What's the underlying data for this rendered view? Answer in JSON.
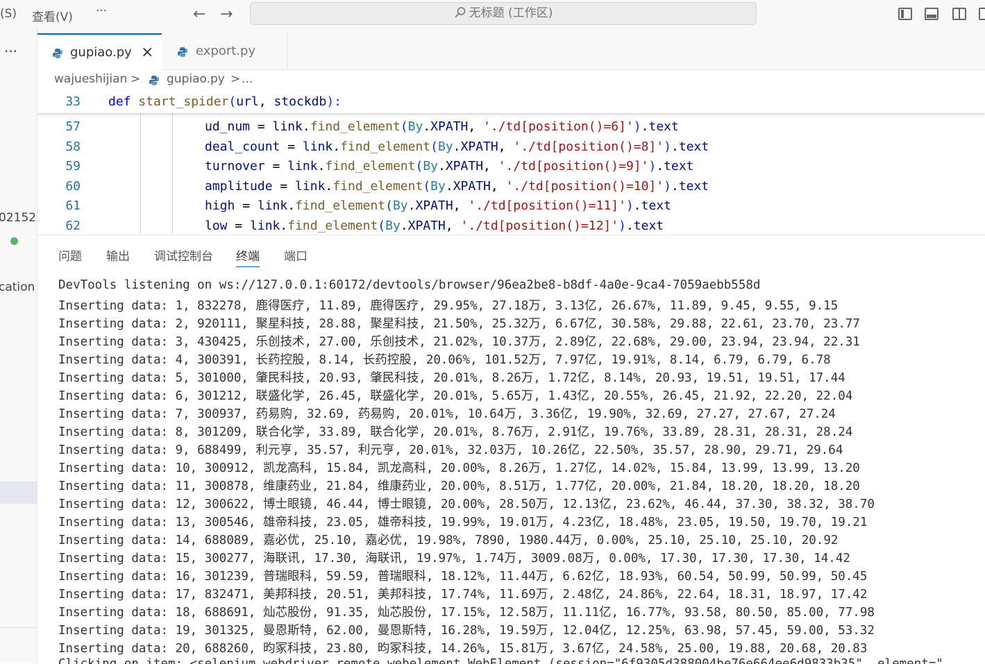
{
  "titlebar": {
    "menu_partial": "(S)",
    "menu_view": "查看(V)",
    "more": "···",
    "back": "←",
    "forward": "→",
    "search": "无标题 (工作区)"
  },
  "sidebar": {
    "more": "···",
    "frag_number": "02152",
    "frag_text": "cation"
  },
  "tabs": [
    {
      "label": "gupiao.py",
      "active": true,
      "close": "×"
    },
    {
      "label": "export.py",
      "active": false
    }
  ],
  "breadcrumb": {
    "folder": "wajueshijian",
    "sep": ">",
    "file": "gupiao.py",
    "more": "..."
  },
  "editor": {
    "sticky": {
      "line": "33",
      "kw": "def",
      "fn": "start_spider",
      "p1": "(",
      "a1": "url",
      "comma": ", ",
      "a2": "stockdb",
      "p2": "):"
    },
    "lines": [
      {
        "num": "57",
        "var": "ud_num",
        "str": "'./td[position()=6]'"
      },
      {
        "num": "58",
        "var": "deal_count",
        "str": "'./td[position()=8]'"
      },
      {
        "num": "59",
        "var": "turnover",
        "str": "'./td[position()=9]'"
      },
      {
        "num": "60",
        "var": "amplitude",
        "str": "'./td[position()=10]'"
      },
      {
        "num": "61",
        "var": "high",
        "str": "'./td[position()=11]'"
      },
      {
        "num": "62",
        "var": "low",
        "str": "'./td[position()=12]'"
      }
    ],
    "tok": {
      "eq": " = ",
      "link": "link",
      "dot": ".",
      "find": "find_element",
      "open": "(",
      "by": "By",
      "xpath": "XPATH",
      "sep": ", ",
      "close": ")",
      "text": "text"
    }
  },
  "panel": {
    "tabs": [
      "问题",
      "输出",
      "调试控制台",
      "终端",
      "端口"
    ],
    "active_tab": "终端",
    "terminal_lines": [
      "DevTools listening on ws://127.0.0.1:60172/devtools/browser/96ea2be8-b8df-4a0e-9ca4-7059aebb558d",
      "Inserting data: 1, 832278, 鹿得医疗, 11.89, 鹿得医疗, 29.95%, 27.18万, 3.13亿, 26.67%, 11.89, 9.45, 9.55, 9.15",
      "Inserting data: 2, 920111, 聚星科技, 28.88, 聚星科技, 21.50%, 25.32万, 6.67亿, 30.58%, 29.88, 22.61, 23.70, 23.77",
      "Inserting data: 3, 430425, 乐创技术, 27.00, 乐创技术, 21.02%, 10.37万, 2.89亿, 22.68%, 29.00, 23.94, 23.94, 22.31",
      "Inserting data: 4, 300391, 长药控股, 8.14, 长药控股, 20.06%, 101.52万, 7.97亿, 19.91%, 8.14, 6.79, 6.79, 6.78",
      "Inserting data: 5, 301000, 肇民科技, 20.93, 肇民科技, 20.01%, 8.26万, 1.72亿, 8.14%, 20.93, 19.51, 19.51, 17.44",
      "Inserting data: 6, 301212, 联盛化学, 26.45, 联盛化学, 20.01%, 5.65万, 1.43亿, 20.55%, 26.45, 21.92, 22.20, 22.04",
      "Inserting data: 7, 300937, 药易购, 32.69, 药易购, 20.01%, 10.64万, 3.36亿, 19.90%, 32.69, 27.27, 27.67, 27.24",
      "Inserting data: 8, 301209, 联合化学, 33.89, 联合化学, 20.01%, 8.76万, 2.91亿, 19.76%, 33.89, 28.31, 28.31, 28.24",
      "Inserting data: 9, 688499, 利元亨, 35.57, 利元亨, 20.01%, 32.03万, 10.26亿, 22.50%, 35.57, 28.90, 29.71, 29.64",
      "Inserting data: 10, 300912, 凯龙高科, 15.84, 凯龙高科, 20.00%, 8.26万, 1.27亿, 14.02%, 15.84, 13.99, 13.99, 13.20",
      "Inserting data: 11, 300878, 维康药业, 21.84, 维康药业, 20.00%, 8.51万, 1.77亿, 20.00%, 21.84, 18.20, 18.20, 18.20",
      "Inserting data: 12, 300622, 博士眼镜, 46.44, 博士眼镜, 20.00%, 28.50万, 12.13亿, 23.62%, 46.44, 37.30, 38.32, 38.70",
      "Inserting data: 13, 300546, 雄帝科技, 23.05, 雄帝科技, 19.99%, 19.01万, 4.23亿, 18.48%, 23.05, 19.50, 19.70, 19.21",
      "Inserting data: 14, 688089, 嘉必优, 25.10, 嘉必优, 19.98%, 7890, 1980.44万, 0.00%, 25.10, 25.10, 25.10, 20.92",
      "Inserting data: 15, 300277, 海联讯, 17.30, 海联讯, 19.97%, 1.74万, 3009.08万, 0.00%, 17.30, 17.30, 17.30, 14.42",
      "Inserting data: 16, 301239, 普瑞眼科, 59.59, 普瑞眼科, 18.12%, 11.44万, 6.62亿, 18.93%, 60.54, 50.99, 50.99, 50.45",
      "Inserting data: 17, 832471, 美邦科技, 20.51, 美邦科技, 17.74%, 11.69万, 2.48亿, 24.86%, 22.64, 18.31, 18.97, 17.42",
      "Inserting data: 18, 688691, 灿芯股份, 91.35, 灿芯股份, 17.15%, 12.58万, 11.11亿, 16.77%, 93.58, 80.50, 85.00, 77.98",
      "Inserting data: 19, 301325, 曼恩斯特, 62.00, 曼恩斯特, 16.28%, 19.59万, 12.04亿, 12.25%, 63.98, 57.45, 59.00, 53.32",
      "Inserting data: 20, 688260, 昀冢科技, 23.80, 昀冢科技, 14.26%, 15.81万, 3.67亿, 24.58%, 25.00, 19.88, 20.68, 20.83",
      "Clicking on item: <selenium.webdriver.remote.webelement.WebElement (session=\"6f9305d388004be76e664ee6d9833b35\", element=\""
    ]
  }
}
